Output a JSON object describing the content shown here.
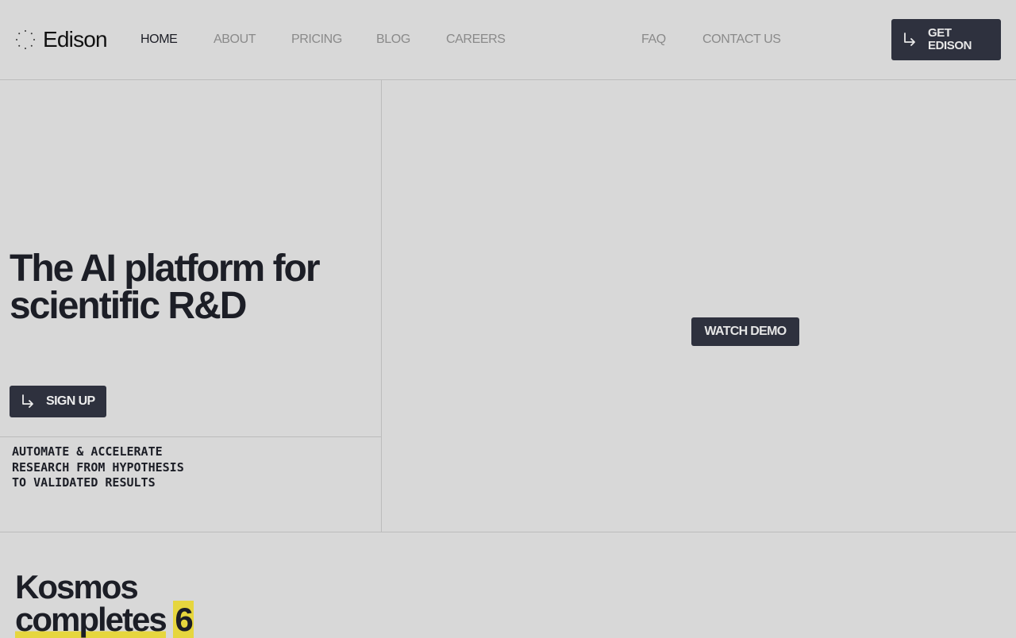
{
  "brand": {
    "name": "Edison"
  },
  "nav": {
    "home": "HOME",
    "about": "ABOUT",
    "pricing": "PRICING",
    "blog": "BLOG",
    "careers": "CAREERS",
    "faq": "FAQ",
    "contact": "CONTACT US"
  },
  "header_cta": {
    "line1": "GET",
    "line2": "EDISON"
  },
  "hero": {
    "title_line1": "The AI platform for",
    "title_line2": "scientific R&D",
    "signup_label": "SIGN UP",
    "subtitle": "AUTOMATE & ACCELERATE\nRESEARCH FROM HYPOTHESIS\nTO VALIDATED RESULTS",
    "watch_demo_label": "WATCH DEMO"
  },
  "section2": {
    "title_line1": "Kosmos",
    "title_word": "completes",
    "title_number": "6"
  },
  "colors": {
    "background": "#d8d8d8",
    "button_dark": "#2e313e",
    "text_dark": "#1c1e26",
    "nav_muted": "#8a8a8a",
    "highlight": "#e6d63e"
  },
  "icons": {
    "logo": "dotted-circle-icon",
    "cta_arrow": "arrow-down-right-icon"
  }
}
